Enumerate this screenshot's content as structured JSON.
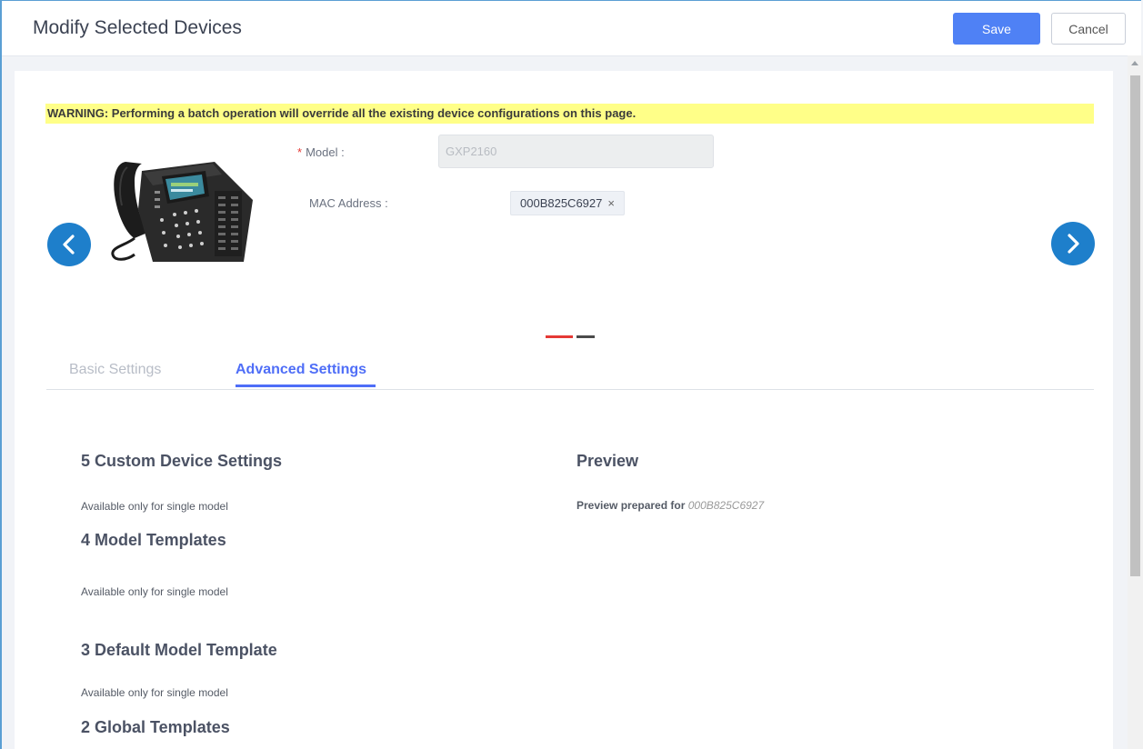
{
  "header": {
    "title": "Modify Selected Devices",
    "save_label": "Save",
    "cancel_label": "Cancel"
  },
  "warning": "WARNING: Performing a batch operation will override all the existing device configurations on this page.",
  "device": {
    "model_label": "Model :",
    "model_value": "GXP2160",
    "mac_label": "MAC Address :",
    "mac_tag": "000B825C6927",
    "mac_remove": "×"
  },
  "tabs": [
    {
      "label": "Basic Settings",
      "active": false
    },
    {
      "label": "Advanced Settings",
      "active": true
    }
  ],
  "sections": [
    {
      "title": "5 Custom Device Settings",
      "note": "Available only for single model"
    },
    {
      "title": "4 Model Templates",
      "note": "Available only for single model"
    },
    {
      "title": "3 Default Model Template",
      "note": "Available only for single model"
    },
    {
      "title": "2 Global Templates"
    }
  ],
  "preview": {
    "title": "Preview",
    "prepared_label": "Preview prepared for",
    "prepared_mac": "000B825C6927"
  },
  "colors": {
    "accent": "#4f6ef7",
    "save_button": "#4f81f5",
    "nav_arrow": "#1e7fcb",
    "warning_bg": "#ffff88",
    "required": "#e53935"
  },
  "icons": [
    "chevron-left-icon",
    "chevron-right-icon",
    "close-icon",
    "ip-phone-image"
  ]
}
